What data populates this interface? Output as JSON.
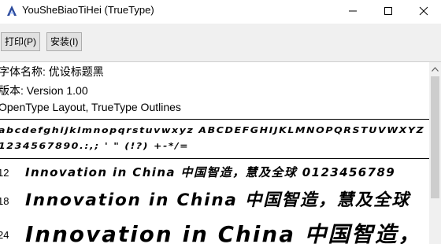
{
  "window": {
    "title": "YouSheBiaoTiHei (TrueType)",
    "app_icon": "font-icon",
    "controls": [
      "minimize-icon",
      "maximize-icon",
      "close-icon"
    ]
  },
  "toolbar": {
    "print_label": "打印(P)",
    "install_label": "安装(I)"
  },
  "info": {
    "font_name": "字体名称: 优设标题黑",
    "version": "版本: Version 1.00",
    "outline": "OpenType Layout, TrueType Outlines"
  },
  "charset": {
    "line1": "abcdefghijklmnopqrstuvwxyz ABCDEFGHIJKLMNOPQRSTUVWXYZ",
    "line2": "1234567890.:,; ' \" (!?) +-*/="
  },
  "samples": [
    {
      "size": "12",
      "text": "Innovation in China 中国智造，慧及全球 0123456789"
    },
    {
      "size": "18",
      "text": "Innovation in China 中国智造，慧及全球"
    },
    {
      "size": "24",
      "text": "Innovation in China 中国智造，"
    }
  ],
  "colors": {
    "toolbar_bg": "#f0f0f0",
    "button_bg": "#e1e1e1",
    "text": "#000000"
  }
}
